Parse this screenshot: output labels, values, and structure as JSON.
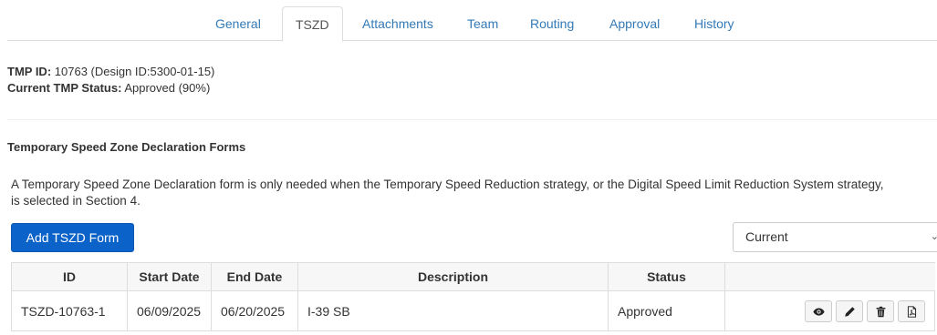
{
  "tabs": [
    {
      "label": "General",
      "active": false
    },
    {
      "label": "TSZD",
      "active": true
    },
    {
      "label": "Attachments",
      "active": false
    },
    {
      "label": "Team",
      "active": false
    },
    {
      "label": "Routing",
      "active": false
    },
    {
      "label": "Approval",
      "active": false
    },
    {
      "label": "History",
      "active": false
    }
  ],
  "info": {
    "tmp_id_label": "TMP ID:",
    "tmp_id_value": " 10763 (Design ID:5300-01-15)",
    "status_label": "Current TMP Status:",
    "status_value": " Approved (90%)"
  },
  "section": {
    "title": "Temporary Speed Zone Declaration Forms",
    "description": "A Temporary Speed Zone Declaration form is only needed when the Temporary Speed Reduction strategy, or the Digital Speed Limit Reduction System strategy, is selected in Section 4."
  },
  "toolbar": {
    "add_label": "Add TSZD Form",
    "filter_value": "Current"
  },
  "table": {
    "headers": [
      "ID",
      "Start Date",
      "End Date",
      "Description",
      "Status",
      ""
    ],
    "rows": [
      [
        "TSZD-10763-1",
        "06/09/2025",
        "06/20/2025",
        "I-39 SB",
        "Approved"
      ]
    ]
  },
  "icons": [
    "eye-icon",
    "pencil-icon",
    "trash-icon",
    "pdf-icon",
    "chevron-down-icon"
  ],
  "colors": {
    "link": "#337ab7",
    "primary_button": "#0b63c9"
  }
}
